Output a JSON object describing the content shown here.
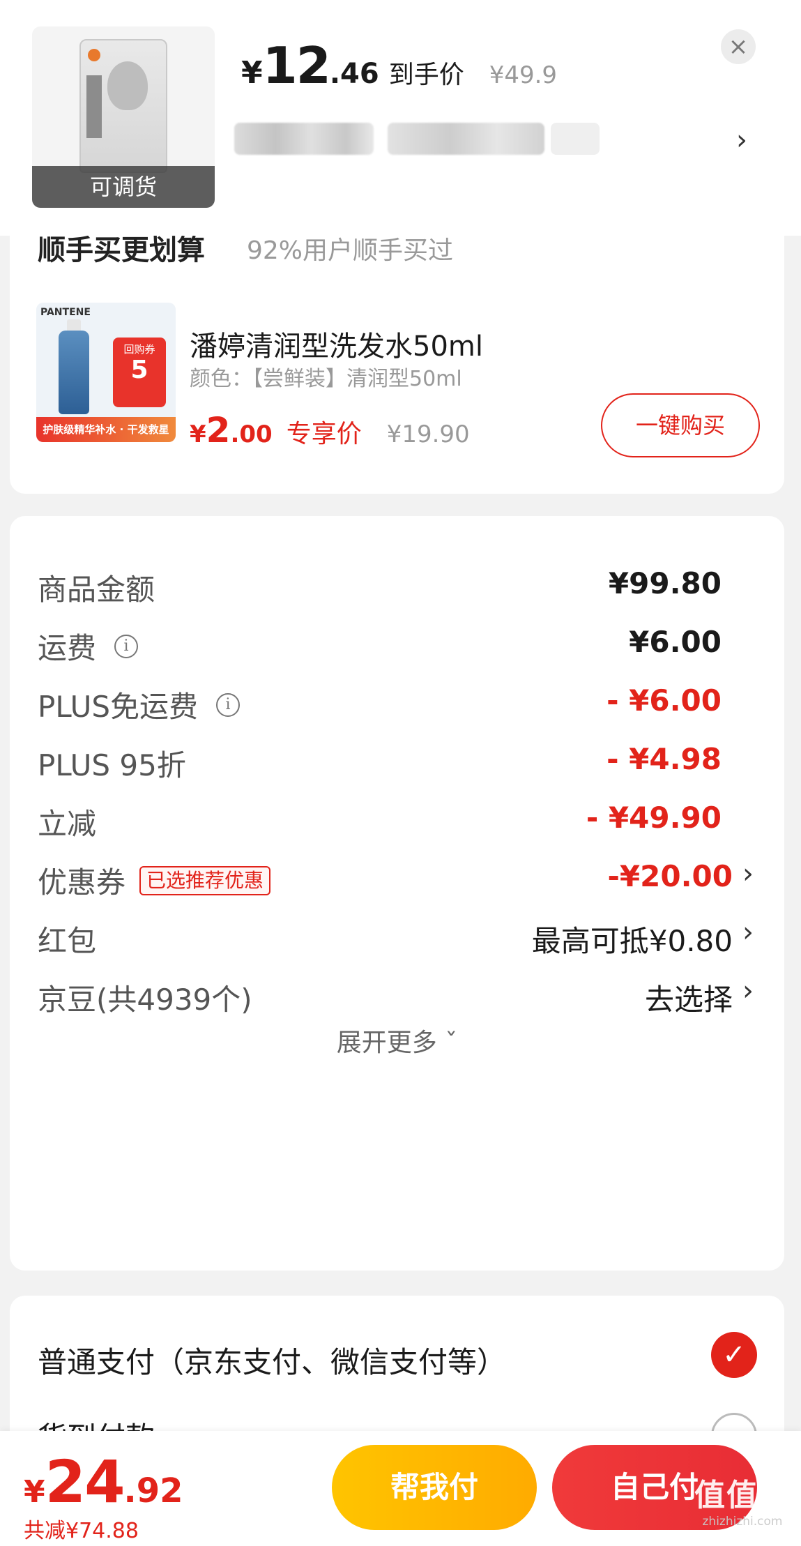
{
  "header": {
    "thumb_tag": "可调货",
    "price_symbol": "¥",
    "price_int": "12",
    "price_dec": ".46",
    "price_label": "到手价",
    "original_price": "¥49.9",
    "close_icon": "×",
    "chevron": "›"
  },
  "upsell": {
    "title": "顺手买更划算",
    "subtitle": "92%用户顺手买过",
    "caret": "^",
    "promo_brand": "PANTENE",
    "promo_coupon_title": "回购券",
    "promo_coupon_num": "5",
    "promo_banner": "护肤级精华补水 · 干发救星",
    "product_name": "潘婷清润型洗发水50ml",
    "product_spec": "颜色：【尝鲜装】清润型50ml",
    "deal_symbol": "¥",
    "deal_int": "2",
    "deal_dec": ".00",
    "deal_label": "专享价",
    "deal_original": "¥19.90",
    "buy_button": "一键购买"
  },
  "summary": {
    "rows": [
      {
        "label": "商品金额",
        "value": "¥99.80"
      },
      {
        "label": "运费",
        "value": "¥6.00",
        "info": "i"
      },
      {
        "label": "PLUS免运费",
        "value": "- ¥6.00",
        "info": "i"
      },
      {
        "label": "PLUS 95折",
        "value": "- ¥4.98"
      },
      {
        "label": "立减",
        "value": "- ¥49.90"
      },
      {
        "label": "优惠券",
        "tag": "已选推荐优惠",
        "value": "-¥20.00",
        "chevron": "›"
      },
      {
        "label": "红包",
        "value": "最高可抵¥0.80",
        "chevron": "›"
      },
      {
        "label": "京豆(共4939个)",
        "value": "去选择",
        "chevron": "›"
      }
    ],
    "expand_label": "展开更多 ˇ"
  },
  "payment": {
    "option1": "普通支付（京东支付、微信支付等）",
    "option1_check": "✓",
    "option2": "货到付款"
  },
  "bottom": {
    "total_symbol": "¥",
    "total_int": "24",
    "total_dec": ".92",
    "saved": "共减¥74.88",
    "help_pay": "帮我付",
    "self_pay": "自己付"
  },
  "watermark": {
    "logo": "值值值",
    "url": "zhizhizhi.com"
  },
  "colors": {
    "accent_red": "#e2231a",
    "gold": "#ffb800"
  }
}
